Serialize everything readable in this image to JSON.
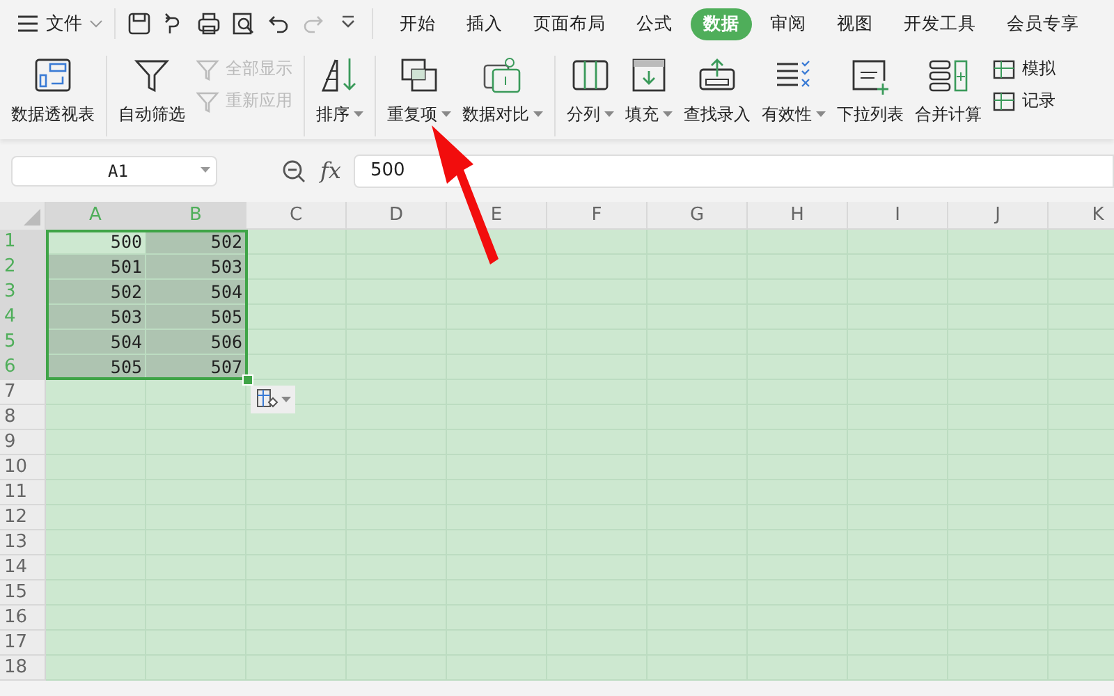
{
  "menu": {
    "label": "文件"
  },
  "tabs": [
    {
      "label": "开始",
      "selected": false
    },
    {
      "label": "插入",
      "selected": false
    },
    {
      "label": "页面布局",
      "selected": false
    },
    {
      "label": "公式",
      "selected": false
    },
    {
      "label": "数据",
      "selected": true
    },
    {
      "label": "审阅",
      "selected": false
    },
    {
      "label": "视图",
      "selected": false
    },
    {
      "label": "开发工具",
      "selected": false
    },
    {
      "label": "会员专享",
      "selected": false
    }
  ],
  "ribbon": [
    {
      "items": [
        {
          "kind": "large",
          "label": "数据透视表",
          "dropdown": false,
          "disabled": false
        }
      ]
    },
    {
      "items": [
        {
          "kind": "large",
          "label": "自动筛选",
          "dropdown": false,
          "disabled": false
        },
        {
          "kind": "small",
          "label": "全部显示",
          "dropdown": false,
          "disabled": true
        },
        {
          "kind": "small",
          "label": "重新应用",
          "dropdown": false,
          "disabled": true
        }
      ]
    },
    {
      "items": [
        {
          "kind": "large",
          "label": "排序",
          "dropdown": true,
          "disabled": false
        }
      ]
    },
    {
      "items": [
        {
          "kind": "large",
          "label": "重复项",
          "dropdown": true,
          "disabled": false
        },
        {
          "kind": "large",
          "label": "数据对比",
          "dropdown": true,
          "disabled": false
        }
      ]
    },
    {
      "items": [
        {
          "kind": "large",
          "label": "分列",
          "dropdown": true,
          "disabled": false
        },
        {
          "kind": "large",
          "label": "填充",
          "dropdown": true,
          "disabled": false
        },
        {
          "kind": "large",
          "label": "查找录入",
          "dropdown": false,
          "disabled": false
        },
        {
          "kind": "large",
          "label": "有效性",
          "dropdown": true,
          "disabled": false
        },
        {
          "kind": "large",
          "label": "下拉列表",
          "dropdown": false,
          "disabled": false
        },
        {
          "kind": "large",
          "label": "合并计算",
          "dropdown": false,
          "disabled": false
        },
        {
          "kind": "small",
          "label": "模拟",
          "dropdown": false,
          "disabled": false
        },
        {
          "kind": "small",
          "label": "记录",
          "dropdown": false,
          "disabled": false
        }
      ]
    }
  ],
  "formula_bar": {
    "name_box": "A1",
    "function_label": "fx",
    "value": "500"
  },
  "columns": [
    {
      "label": "A",
      "selected": true
    },
    {
      "label": "B",
      "selected": true
    },
    {
      "label": "C",
      "selected": false
    },
    {
      "label": "D",
      "selected": false
    },
    {
      "label": "E",
      "selected": false
    },
    {
      "label": "F",
      "selected": false
    },
    {
      "label": "G",
      "selected": false
    },
    {
      "label": "H",
      "selected": false
    },
    {
      "label": "I",
      "selected": false
    },
    {
      "label": "J",
      "selected": false
    },
    {
      "label": "K",
      "selected": false
    }
  ],
  "rows": [
    {
      "label": "1",
      "selected": true,
      "cells": [
        {
          "value": "500",
          "active": true
        },
        {
          "value": "502",
          "active": false
        }
      ]
    },
    {
      "label": "2",
      "selected": true,
      "cells": [
        {
          "value": "501",
          "active": false
        },
        {
          "value": "503",
          "active": false
        }
      ]
    },
    {
      "label": "3",
      "selected": true,
      "cells": [
        {
          "value": "502",
          "active": false
        },
        {
          "value": "504",
          "active": false
        }
      ]
    },
    {
      "label": "4",
      "selected": true,
      "cells": [
        {
          "value": "503",
          "active": false
        },
        {
          "value": "505",
          "active": false
        }
      ]
    },
    {
      "label": "5",
      "selected": true,
      "cells": [
        {
          "value": "504",
          "active": false
        },
        {
          "value": "506",
          "active": false
        }
      ]
    },
    {
      "label": "6",
      "selected": true,
      "cells": [
        {
          "value": "505",
          "active": false
        },
        {
          "value": "507",
          "active": false
        }
      ]
    },
    {
      "label": "7",
      "selected": false,
      "cells": []
    },
    {
      "label": "8",
      "selected": false,
      "cells": []
    },
    {
      "label": "9",
      "selected": false,
      "cells": []
    },
    {
      "label": "10",
      "selected": false,
      "cells": []
    },
    {
      "label": "11",
      "selected": false,
      "cells": []
    },
    {
      "label": "12",
      "selected": false,
      "cells": []
    },
    {
      "label": "13",
      "selected": false,
      "cells": []
    },
    {
      "label": "14",
      "selected": false,
      "cells": []
    },
    {
      "label": "15",
      "selected": false,
      "cells": []
    },
    {
      "label": "16",
      "selected": false,
      "cells": []
    },
    {
      "label": "17",
      "selected": false,
      "cells": []
    },
    {
      "label": "18",
      "selected": false,
      "cells": []
    }
  ]
}
